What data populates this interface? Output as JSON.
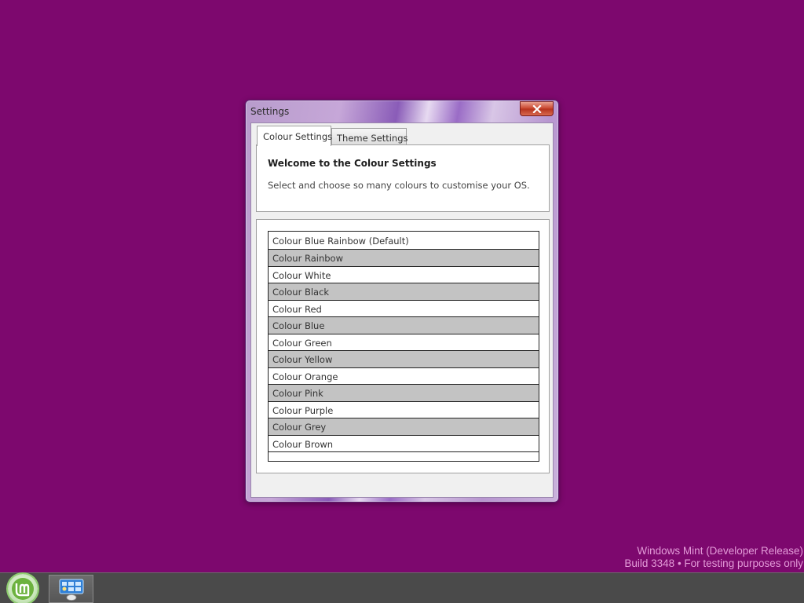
{
  "window": {
    "title": "Settings",
    "close_icon": "close-icon"
  },
  "tabs": [
    {
      "label": "Colour Settings",
      "active": true
    },
    {
      "label": "Theme Settings",
      "active": false
    }
  ],
  "welcome": {
    "title": "Welcome to the Colour Settings",
    "description": "Select and choose so many colours to customise your OS."
  },
  "colour_list": {
    "items": [
      {
        "label": "Colour Blue Rainbow (Default)",
        "shaded": false
      },
      {
        "label": "Colour Rainbow",
        "shaded": true
      },
      {
        "label": "Colour White",
        "shaded": false
      },
      {
        "label": "Colour Black",
        "shaded": true
      },
      {
        "label": "Colour Red",
        "shaded": false
      },
      {
        "label": "Colour Blue",
        "shaded": true
      },
      {
        "label": "Colour Green",
        "shaded": false
      },
      {
        "label": "Colour Yellow",
        "shaded": true
      },
      {
        "label": "Colour Orange",
        "shaded": false
      },
      {
        "label": "Colour Pink",
        "shaded": true
      },
      {
        "label": "Colour Purple",
        "shaded": false
      },
      {
        "label": "Colour Grey",
        "shaded": true
      },
      {
        "label": "Colour Brown",
        "shaded": false
      }
    ]
  },
  "watermark": {
    "line1": "Windows Mint (Developer Release)",
    "line2": "Build 3348 • For testing purposes only"
  },
  "taskbar": {
    "start_icon": "linux-mint-logo-icon",
    "task_icon": "settings-app-icon"
  },
  "colors": {
    "desktop": "#7d086e",
    "taskbar": "#4a4a4a",
    "list_shade": "#c3c3c3",
    "watermark": "#e39bd8"
  }
}
